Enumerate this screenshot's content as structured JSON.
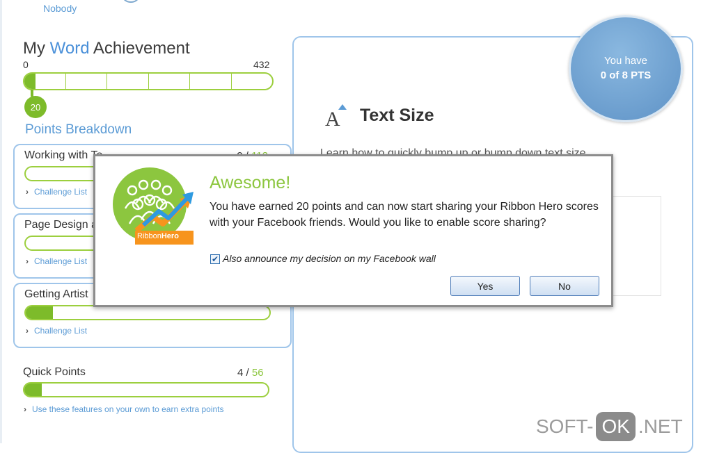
{
  "user": {
    "name": "Nobody"
  },
  "achievement": {
    "title_pre": "My ",
    "title_word": "Word",
    "title_post": " Achievement",
    "min": "0",
    "max": "432",
    "current": "20",
    "progress_fraction": 0.046
  },
  "breakdown": {
    "title": "Points Breakdown",
    "challenge_link": "Challenge List",
    "cards": [
      {
        "title": "Working with Te",
        "score": "0",
        "total": "112",
        "progress": 0
      },
      {
        "title": "Page Design a",
        "score": "",
        "total": "",
        "progress": 0
      },
      {
        "title": "Getting Artist",
        "score": "",
        "total": "",
        "progress": 0.11
      }
    ]
  },
  "quick_points": {
    "title": "Quick Points",
    "score": "4",
    "total": "56",
    "progress": 0.07,
    "link": "Use these features on your own to earn extra points"
  },
  "pts_badge": {
    "line1": "You have",
    "line2": "0  of  8 PTS"
  },
  "challenge": {
    "title": "Text Size",
    "description": "Learn how to quickly bump up or bump down text size."
  },
  "dialog": {
    "logo_text_1": "Ribbon",
    "logo_text_2": "Hero",
    "title": "Awesome!",
    "body": "You have earned 20 points and can now start sharing your Ribbon Hero scores with your Facebook friends. Would you like to enable score sharing?",
    "checkbox_label": "Also announce my decision on my Facebook wall",
    "checkbox_checked": true,
    "yes_label": "Yes",
    "no_label": "No"
  },
  "watermark": {
    "pre": "SOFT-",
    "ok": "OK",
    "post": ".NET"
  },
  "colors": {
    "green": "#8cc63f",
    "blue": "#5b9bd5",
    "badge": "#6fa2d2"
  }
}
